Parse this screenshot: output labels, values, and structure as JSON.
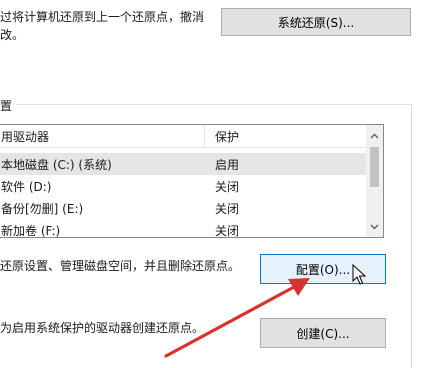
{
  "restore_section": {
    "description_line1": "过将计算机还原到上一个还原点，撤消",
    "description_line2": "改。",
    "system_restore_button": "系统还原(S)..."
  },
  "protection_group": {
    "title": "置"
  },
  "drive_list": {
    "columns": [
      "用驱动器",
      "保护"
    ],
    "rows": [
      {
        "drive": "本地磁盘 (C:) (系统)",
        "protection": "启用",
        "selected": true
      },
      {
        "drive": "软件 (D:)",
        "protection": "关闭"
      },
      {
        "drive": "备份[勿删] (E:)",
        "protection": "关闭"
      },
      {
        "drive": "新加卷 (F:)",
        "protection": "关闭"
      }
    ]
  },
  "configure_section": {
    "description": "还原设置、管理磁盘空间，并且删除还原点。",
    "configure_button": "配置(O)..."
  },
  "create_section": {
    "description": "为启用系统保护的驱动器创建还原点。",
    "create_button": "创建(C)..."
  },
  "colors": {
    "annotation_arrow": "#d9322b",
    "focus_border": "#0078d7"
  }
}
